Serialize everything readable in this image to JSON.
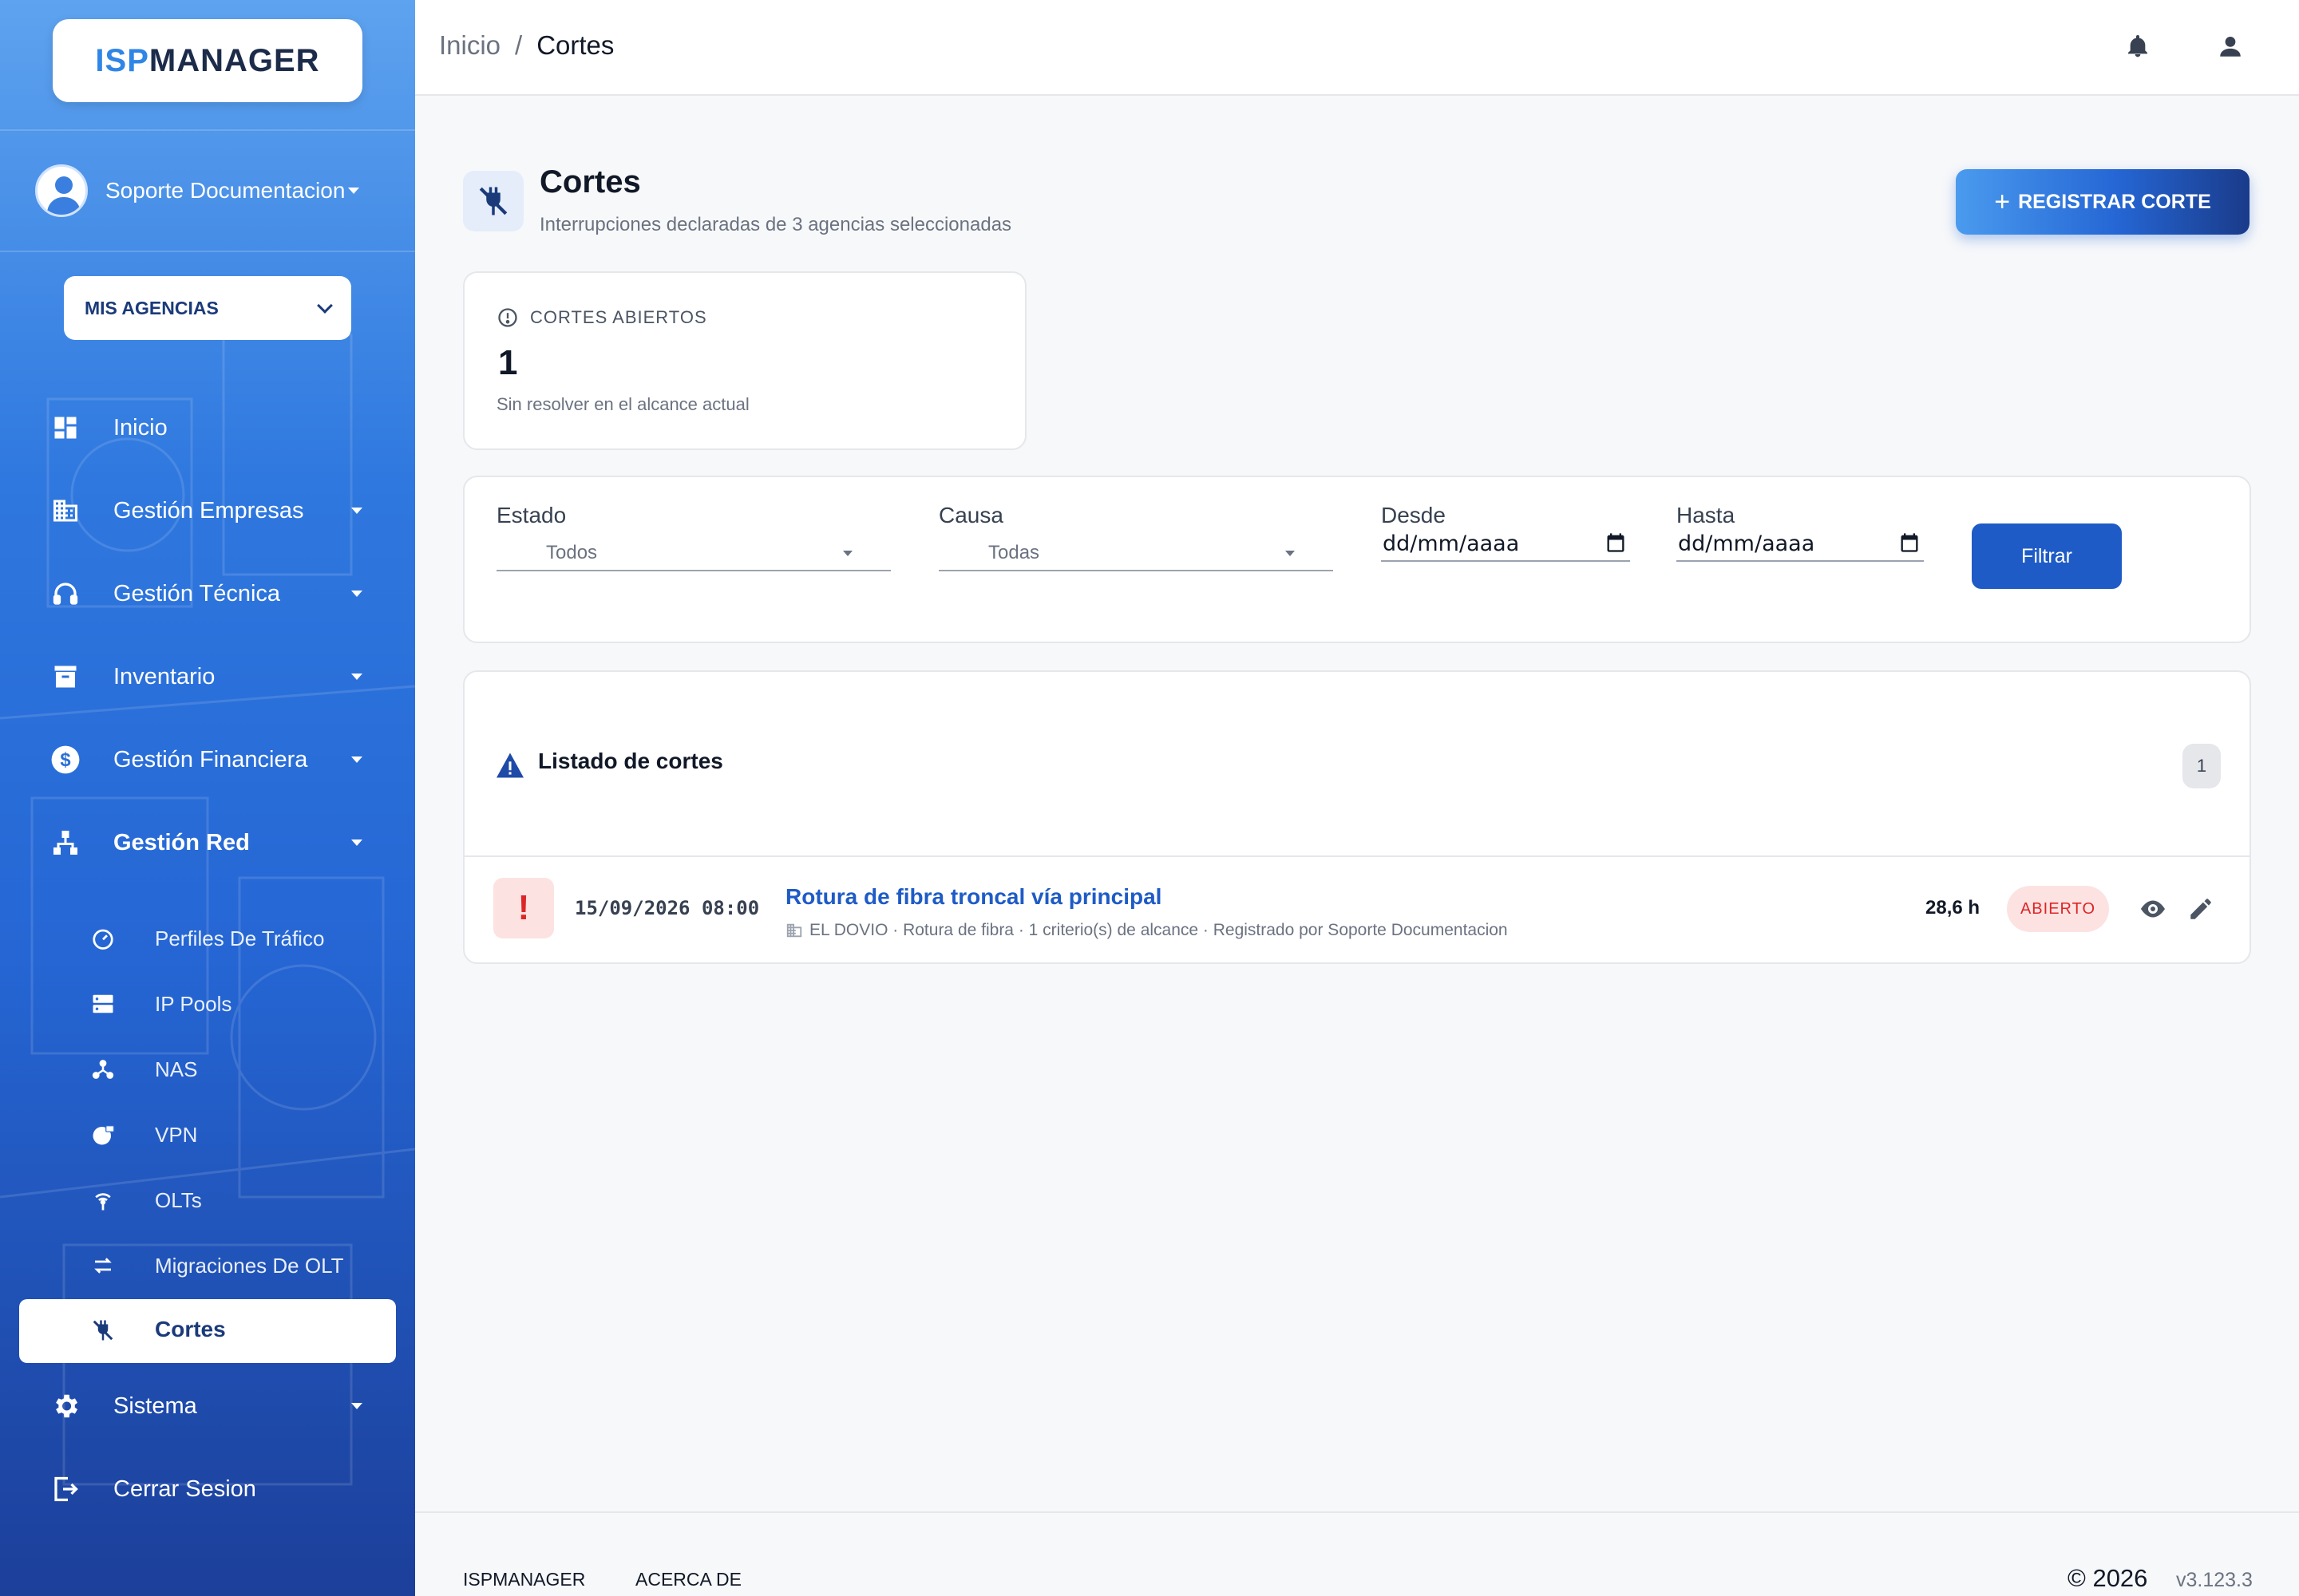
{
  "brand": {
    "part1": "ISP",
    "part2": "MANAGER"
  },
  "user": {
    "name": "Soporte Documentacion"
  },
  "agency_select": {
    "label": "MIS AGENCIAS"
  },
  "nav": {
    "inicio": "Inicio",
    "empresas": "Gestión Empresas",
    "tecnica": "Gestión Técnica",
    "inventario": "Inventario",
    "financiera": "Gestión Financiera",
    "red": "Gestión Red",
    "sistema": "Sistema",
    "logout": "Cerrar Sesion"
  },
  "subnav": {
    "perfiles": "Perfiles De Tráfico",
    "ippools": "IP Pools",
    "nas": "NAS",
    "vpn": "VPN",
    "olts": "OLTs",
    "migraciones": "Migraciones De OLT",
    "cortes": "Cortes"
  },
  "breadcrumb": {
    "home": "Inicio",
    "sep": "/",
    "current": "Cortes"
  },
  "page": {
    "title": "Cortes",
    "subtitle": "Interrupciones declaradas de 3 agencias seleccionadas",
    "action_label": "REGISTRAR CORTE"
  },
  "stat": {
    "label": "CORTES ABIERTOS",
    "value": "1",
    "note": "Sin resolver en el alcance actual"
  },
  "filters": {
    "estado_label": "Estado",
    "estado_value": "Todos",
    "causa_label": "Causa",
    "causa_value": "Todas",
    "desde_label": "Desde",
    "desde_value": "dd/mm/aaaa",
    "hasta_label": "Hasta",
    "hasta_value": "dd/mm/aaaa",
    "button": "Filtrar"
  },
  "list": {
    "title": "Listado de cortes",
    "count": "1",
    "rows": [
      {
        "date": "15/09/2026 08:00",
        "title": "Rotura de fibra troncal vía principal",
        "meta": "EL DOVIO · Rotura de fibra · 1 criterio(s) de alcance · Registrado por Soporte Documentacion",
        "hours": "28,6 h",
        "status": "ABIERTO"
      }
    ]
  },
  "footer": {
    "link1": "ISPMANAGER",
    "link2": "ACERCA DE",
    "copyright": "© 2026",
    "version": "v3.123.3"
  },
  "colors": {
    "primary": "#1e5bc6",
    "danger": "#dc2626",
    "sidebar_top": "#5ea3ef",
    "sidebar_bottom": "#1c3f9a"
  }
}
